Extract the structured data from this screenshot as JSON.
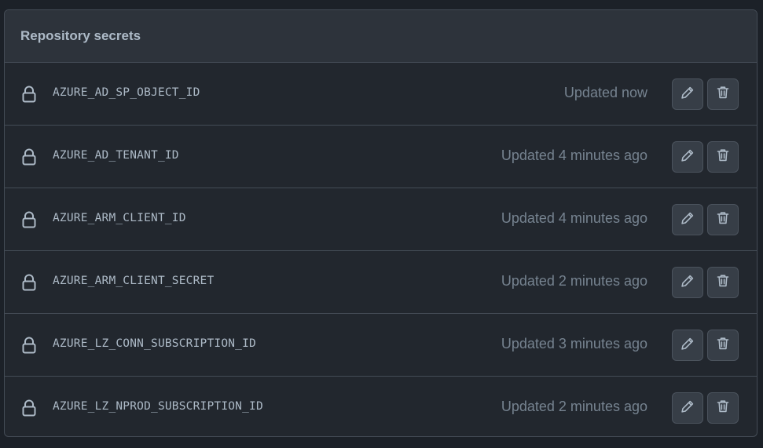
{
  "panel": {
    "title": "Repository secrets"
  },
  "secrets": [
    {
      "name": "AZURE_AD_SP_OBJECT_ID",
      "updated": "Updated now"
    },
    {
      "name": "AZURE_AD_TENANT_ID",
      "updated": "Updated 4 minutes ago"
    },
    {
      "name": "AZURE_ARM_CLIENT_ID",
      "updated": "Updated 4 minutes ago"
    },
    {
      "name": "AZURE_ARM_CLIENT_SECRET",
      "updated": "Updated 2 minutes ago"
    },
    {
      "name": "AZURE_LZ_CONN_SUBSCRIPTION_ID",
      "updated": "Updated 3 minutes ago"
    },
    {
      "name": "AZURE_LZ_NPROD_SUBSCRIPTION_ID",
      "updated": "Updated 2 minutes ago"
    }
  ],
  "icons": {
    "lock": "lock-icon",
    "edit": "pencil-icon",
    "delete": "trash-icon"
  },
  "colors": {
    "background": "#1c2128",
    "panel": "#22272e",
    "header": "#2d333b",
    "border": "#444c56",
    "text": "#adbac7",
    "muted": "#768390",
    "button": "#373e47"
  }
}
